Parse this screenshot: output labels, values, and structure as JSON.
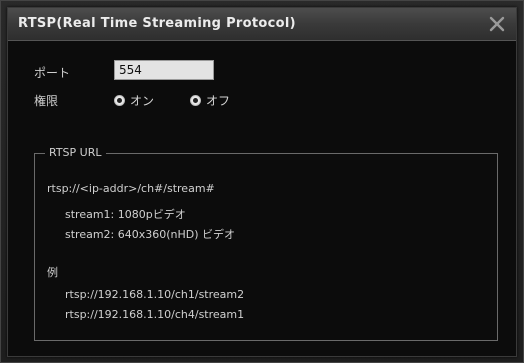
{
  "dialog": {
    "title": "RTSP(Real Time Streaming Protocol)"
  },
  "form": {
    "port_label": "ポート",
    "port_value": "554",
    "auth_label": "権限",
    "auth_options": [
      "オン",
      "オフ"
    ],
    "auth_selected": "オン"
  },
  "rtsp_url": {
    "legend": "RTSP URL",
    "format": "rtsp://<ip-addr>/ch#/stream#",
    "stream1": "stream1: 1080pビデオ",
    "stream2": "stream2: 640x360(nHD) ビデオ",
    "example_label": "例",
    "examples": [
      "rtsp://192.168.1.10/ch1/stream2",
      "rtsp://192.168.1.10/ch4/stream1"
    ]
  },
  "icons": {
    "close": "close-icon"
  }
}
